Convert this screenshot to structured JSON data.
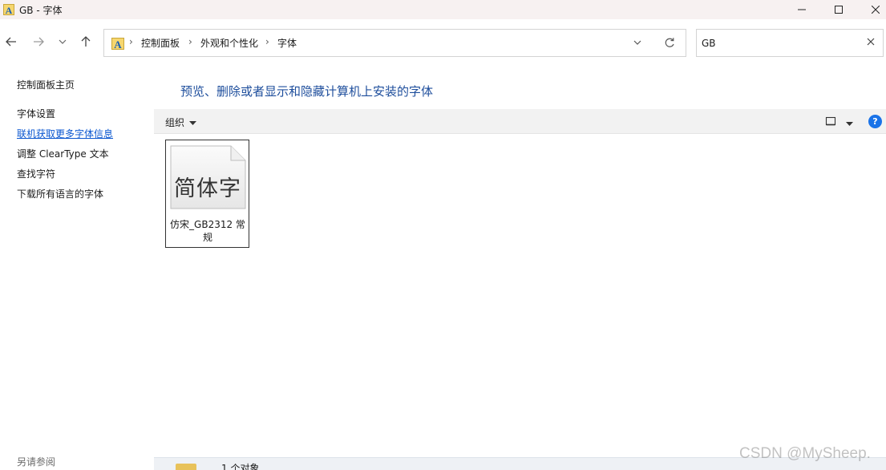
{
  "window": {
    "title": "GB - 字体"
  },
  "nav": {
    "breadcrumbs": [
      "控制面板",
      "外观和个性化",
      "字体"
    ]
  },
  "search": {
    "value": "GB"
  },
  "left_pane": {
    "items": [
      {
        "label": "控制面板主页",
        "link": false
      },
      {
        "label": "字体设置",
        "link": false
      },
      {
        "label": "联机获取更多字体信息",
        "link": true
      },
      {
        "label": "调整 ClearType 文本",
        "link": false
      },
      {
        "label": "查找字符",
        "link": false
      },
      {
        "label": "下载所有语言的字体",
        "link": false
      }
    ],
    "see_also": "另请参阅"
  },
  "main": {
    "heading": "预览、删除或者显示和隐藏计算机上安装的字体",
    "toolbar": {
      "organize_label": "组织",
      "help_label": "?"
    },
    "fonts": [
      {
        "preview": "简体字",
        "name": "仿宋_GB2312 常规"
      }
    ]
  },
  "status": {
    "count_text": "1 个对象"
  },
  "watermark": "CSDN @MySheep."
}
